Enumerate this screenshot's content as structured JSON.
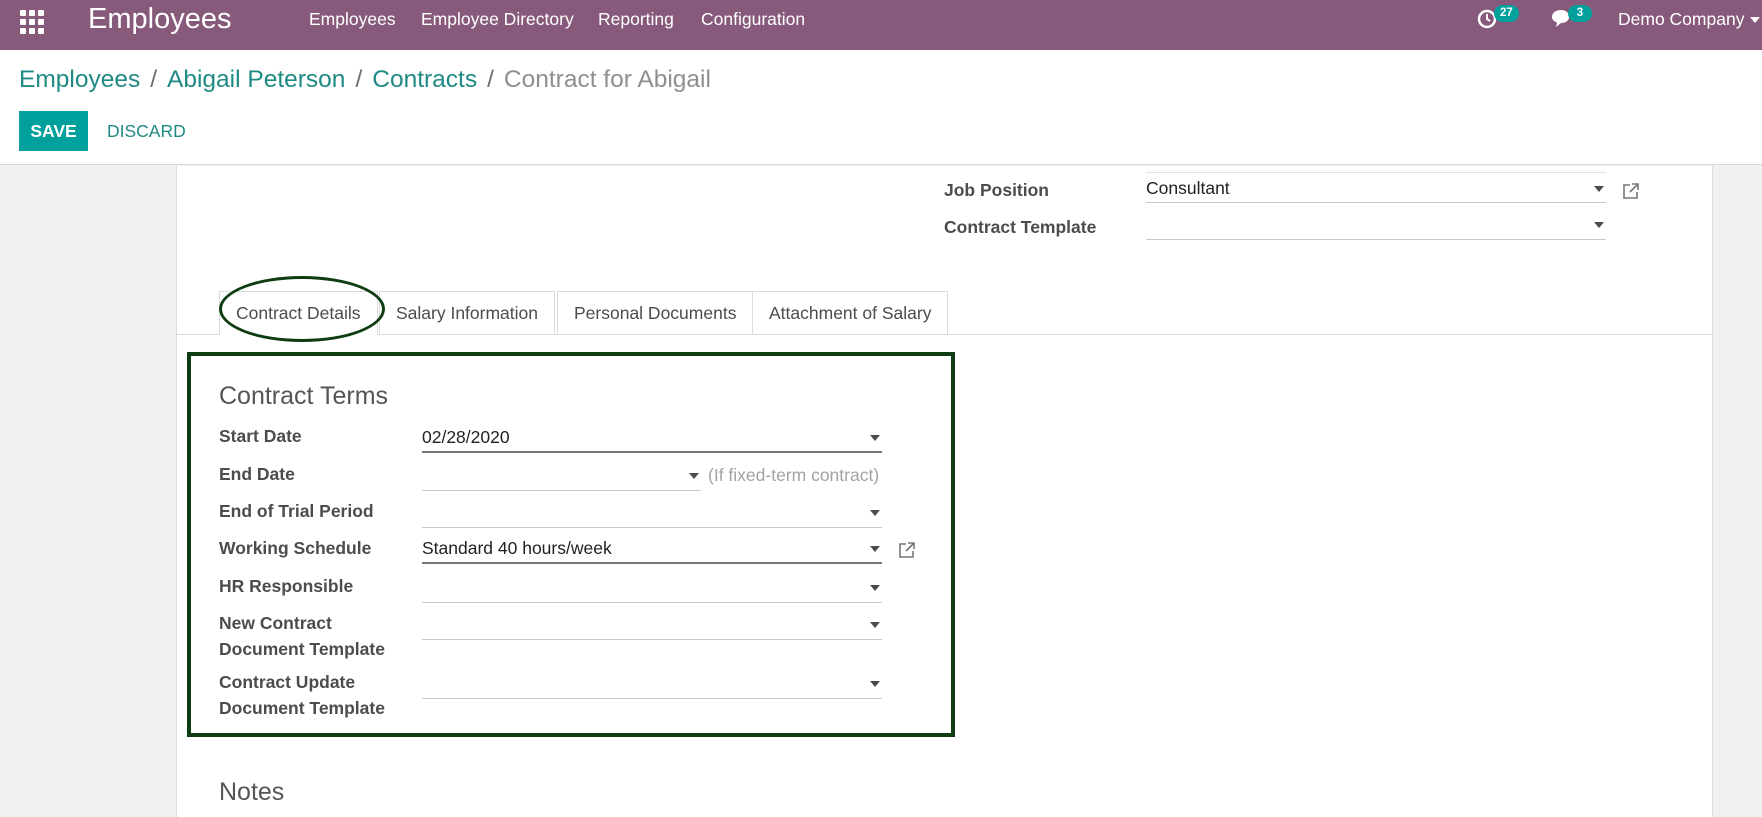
{
  "topbar": {
    "app_title": "Employees",
    "menu": [
      "Employees",
      "Employee Directory",
      "Reporting",
      "Configuration"
    ],
    "activity_count": "27",
    "message_count": "3",
    "company": "Demo Company"
  },
  "breadcrumb": {
    "items": [
      "Employees",
      "Abigail Peterson",
      "Contracts"
    ],
    "separator": "/",
    "current": "Contract for Abigail"
  },
  "actions": {
    "save": "Save",
    "discard": "Discard"
  },
  "header_fields": {
    "job_position": {
      "label": "Job Position",
      "value": "Consultant"
    },
    "contract_template": {
      "label": "Contract Template",
      "value": ""
    }
  },
  "tabs": [
    "Contract Details",
    "Salary Information",
    "Personal Documents",
    "Attachment of Salary"
  ],
  "contract_terms": {
    "title": "Contract Terms",
    "start_date": {
      "label": "Start Date",
      "value": "02/28/2020"
    },
    "end_date": {
      "label": "End Date",
      "value": "",
      "hint": "(If fixed-term contract)"
    },
    "trial_end": {
      "label": "End of Trial Period",
      "value": ""
    },
    "working_schedule": {
      "label": "Working Schedule",
      "value": "Standard 40 hours/week"
    },
    "hr_responsible": {
      "label": "HR Responsible",
      "value": ""
    },
    "new_contract_template": {
      "label_line1": "New Contract",
      "label_line2": "Document Template",
      "value": ""
    },
    "update_contract_template": {
      "label_line1": "Contract Update",
      "label_line2": "Document Template",
      "value": ""
    }
  },
  "notes": {
    "title": "Notes"
  },
  "colors": {
    "brand": "#875a7b",
    "accent": "#00a09d",
    "link": "#1f8a84",
    "annotation": "#0f3d12"
  },
  "icons": [
    "apps-grid-icon",
    "activity-clock-icon",
    "chat-bubbles-icon",
    "external-link-icon",
    "caret-down-icon"
  ]
}
